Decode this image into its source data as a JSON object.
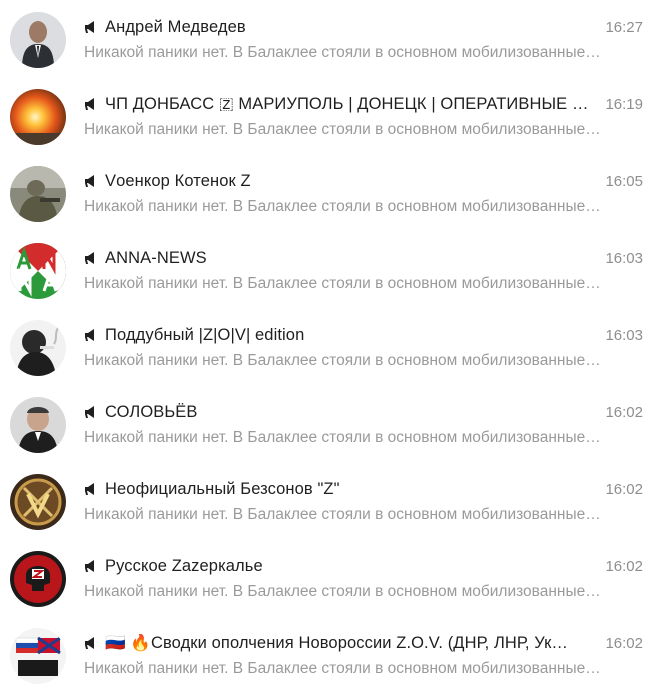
{
  "chats": [
    {
      "title": "Андрей Медведев",
      "time": "16:27",
      "preview": "Никакой паники нет. В Балаклее стояли в основном мобилизованные…",
      "avatar_icon": "person-avatar-icon"
    },
    {
      "title": "ЧП ДОНБАСС 🇿 МАРИУПОЛЬ | ДОНЕЦК | ОПЕРАТИВНЫЕ С…",
      "time": "16:19",
      "preview": "Никакой паники нет. В Балаклее стояли в основном мобилизованные…",
      "avatar_icon": "explosion-avatar-icon"
    },
    {
      "title": "Vоенкор Котенок Z",
      "time": "16:05",
      "preview": "Никакой паники нет. В Балаклее стояли в основном мобилизованные…",
      "avatar_icon": "soldier-avatar-icon"
    },
    {
      "title": "ANNA-NEWS",
      "time": "16:03",
      "preview": "Никакой паники нет. В Балаклее стояли в основном мобилизованные…",
      "avatar_icon": "anna-news-logo-icon"
    },
    {
      "title": "Поддубный |Z|O|V| edition",
      "time": "16:03",
      "preview": "Никакой паники нет. В Балаклее стояли в основном мобилизованные…",
      "avatar_icon": "smoking-person-avatar-icon"
    },
    {
      "title": "СОЛОВЬЁВ",
      "time": "16:02",
      "preview": "Никакой паники нет. В Балаклее стояли в основном мобилизованные…",
      "avatar_icon": "person-avatar-icon"
    },
    {
      "title": "Неофициальный Безсонов \"Z\"",
      "time": "16:02",
      "preview": "Никакой паники нет. В Балаклее стояли в основном мобилизованные…",
      "avatar_icon": "emblem-avatar-icon"
    },
    {
      "title": "Русское Zazеркалье",
      "time": "16:02",
      "preview": "Никакой паники нет. В Балаклее стояли в основном мобилизованные…",
      "avatar_icon": "skull-z-avatar-icon"
    },
    {
      "title": "🇷🇺 🔥Сводки ополчения Новороссии Z.O.V. (ДНР, ЛНР, Ук…",
      "time": "16:02",
      "preview": "Никакой паники нет. В Балаклее стояли в основном мобилизованные…",
      "avatar_icon": "flags-avatar-icon"
    }
  ],
  "colors": {
    "title": "#1f1f1f",
    "time": "#8e8e8e",
    "preview": "#9a9a9a",
    "background": "#ffffff"
  }
}
